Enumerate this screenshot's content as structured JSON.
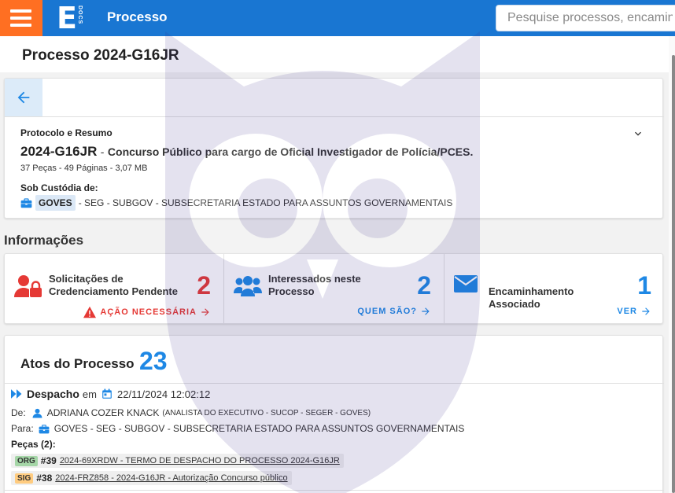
{
  "header": {
    "app_title": "Processo",
    "logo_letter": "E",
    "logo_sub": "DOCS",
    "search_placeholder": "Pesquise processos, encaminhamentos",
    "colors": {
      "topbar": "#1976d2",
      "menu": "#ff6f22"
    }
  },
  "page": {
    "title": "Processo 2024-G16JR"
  },
  "protocol": {
    "section_label": "Protocolo e Resumo",
    "code": "2024-G16JR",
    "separator": "-",
    "description": "Concurso Público para cargo de Oficial Investigador de Polícia/PCES.",
    "meta": "37 Peças - 49 Páginas - 3,07 MB",
    "custody_label": "Sob Custódia de:",
    "custody_org": "GOVES",
    "custody_path": "- SEG - SUBGOV - SUBSECRETARIA ESTADO PARA ASSUNTOS GOVERNAMENTAIS"
  },
  "info": {
    "title": "Informações",
    "items": [
      {
        "label": "Solicitações de Credenciamento Pendente",
        "count": "2",
        "action": "AÇÃO NECESSÁRIA",
        "color": "#e53935"
      },
      {
        "label": "Interessados neste Processo",
        "count": "2",
        "action": "QUEM SÃO?",
        "color": "#1e88e5"
      },
      {
        "label": "Encaminhamento Associado",
        "count": "1",
        "action": "VER",
        "color": "#1e88e5"
      }
    ]
  },
  "atos": {
    "title": "Atos do Processo",
    "count": "23",
    "entry": {
      "type": "Despacho",
      "em": "em",
      "datetime": "22/11/2024 12:02:12",
      "de_label": "De:",
      "de_name": "ADRIANA COZER KNACK",
      "de_role": "(ANALISTA DO EXECUTIVO - SUCOP - SEGER - GOVES)",
      "para_label": "Para:",
      "para_value": "GOVES - SEG - SUBGOV - SUBSECRETARIA ESTADO PARA ASSUNTOS GOVERNAMENTAIS",
      "pecas_label": "Peças (2):",
      "pecas": [
        {
          "tag": "ORG",
          "num": "#39",
          "text": "2024-69XRDW - TERMO DE DESPACHO DO PROCESSO 2024-G16JR",
          "tag_bg": "#a5d6a7"
        },
        {
          "tag": "SIG",
          "num": "#38",
          "text": "2024-FRZ858 - 2024-G16JR - Autorização Concurso público",
          "tag_bg": "#ffcc80"
        }
      ]
    }
  }
}
